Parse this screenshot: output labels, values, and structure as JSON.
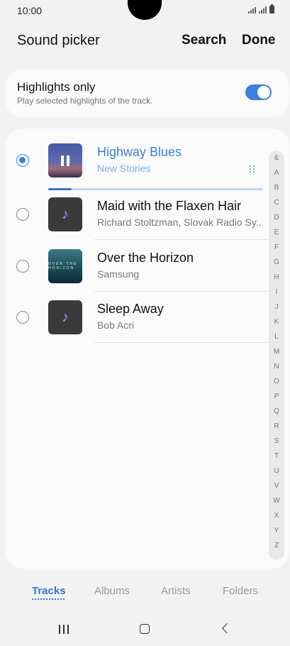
{
  "status_bar": {
    "time": "10:00"
  },
  "header": {
    "title": "Sound picker",
    "search_label": "Search",
    "done_label": "Done"
  },
  "highlights": {
    "title": "Highlights only",
    "subtitle": "Play selected highlights of the track.",
    "enabled": true
  },
  "tracks": [
    {
      "title": "Highway Blues",
      "artist": "New Stories",
      "selected": true,
      "playing": true,
      "art_icon": "pause-icon",
      "progress": 0.11
    },
    {
      "title": "Maid with the Flaxen Hair",
      "artist": "Richard Stoltzman, Slovak Radio Sy...",
      "selected": false,
      "art_icon": "music-note-icon"
    },
    {
      "title": "Over the Horizon",
      "artist": "Samsung",
      "selected": false,
      "art_icon": "album-art-horizon",
      "art_text": "OVER THE HORIZON"
    },
    {
      "title": "Sleep Away",
      "artist": "Bob Acri",
      "selected": false,
      "art_icon": "music-note-icon"
    }
  ],
  "index_letters": [
    "&",
    "A",
    "B",
    "C",
    "D",
    "E",
    "F",
    "G",
    "H",
    "I",
    "J",
    "K",
    "L",
    "M",
    "N",
    "O",
    "P",
    "Q",
    "R",
    "S",
    "T",
    "U",
    "V",
    "W",
    "X",
    "Y",
    "Z"
  ],
  "tabs": [
    {
      "label": "Tracks",
      "active": true
    },
    {
      "label": "Albums",
      "active": false
    },
    {
      "label": "Artists",
      "active": false
    },
    {
      "label": "Folders",
      "active": false
    }
  ],
  "colors": {
    "accent": "#3b7fe0",
    "progress": "#2d78d6"
  }
}
